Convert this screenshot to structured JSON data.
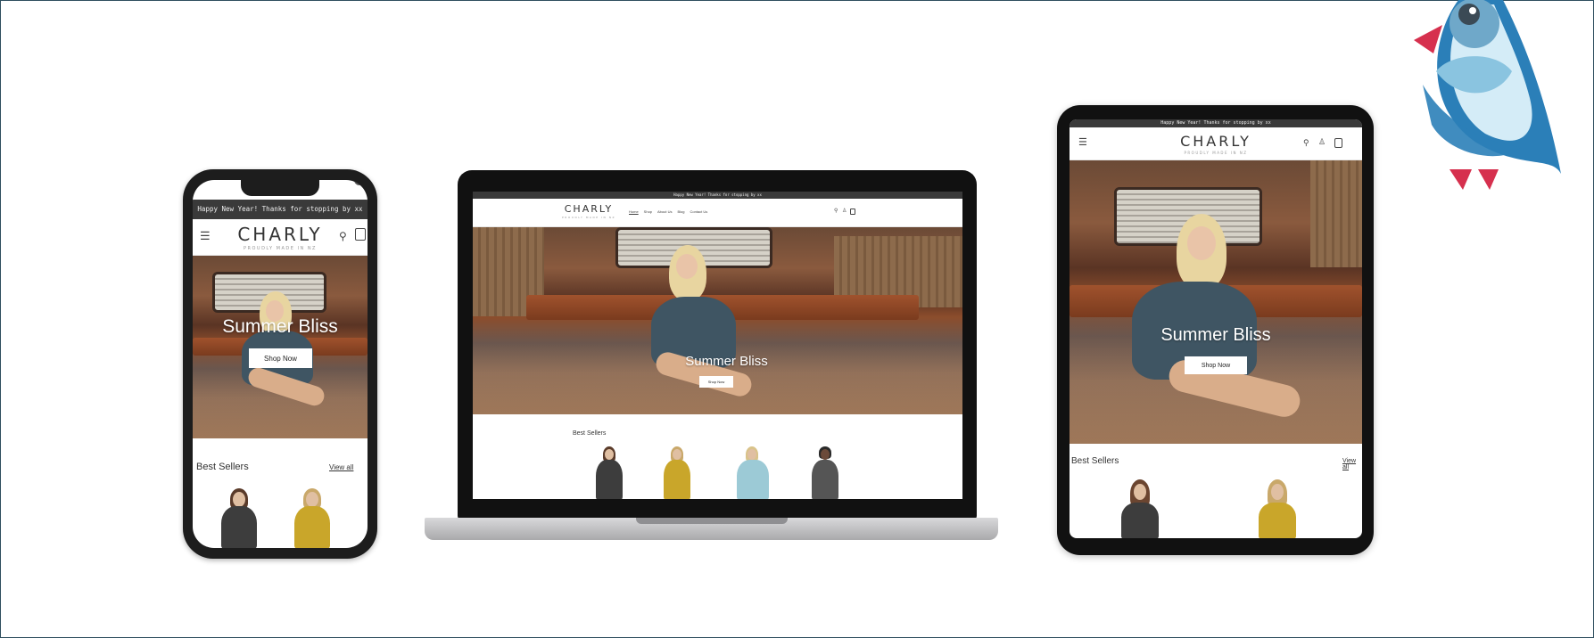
{
  "brand": {
    "name": "CHARLY",
    "tagline": "PROUDLY MADE IN NZ"
  },
  "announcement": "Happy New Year! Thanks for stopping by xx",
  "nav": {
    "items": [
      "Home",
      "Shop",
      "About Us",
      "Blog",
      "Contact Us"
    ]
  },
  "hero": {
    "title": "Summer Bliss",
    "button_label": "Shop Now"
  },
  "best_sellers": {
    "title": "Best Sellers",
    "view_all": "View all"
  },
  "icons": {
    "menu": "hamburger-menu-icon",
    "search": "search-icon",
    "account": "account-icon",
    "cart": "cart-icon"
  },
  "colors": {
    "announcement_bg": "#3a3a3a",
    "sweater_navy": "#3f5563",
    "bird_blue": "#2b7fb8",
    "bird_red": "#d6304e"
  }
}
